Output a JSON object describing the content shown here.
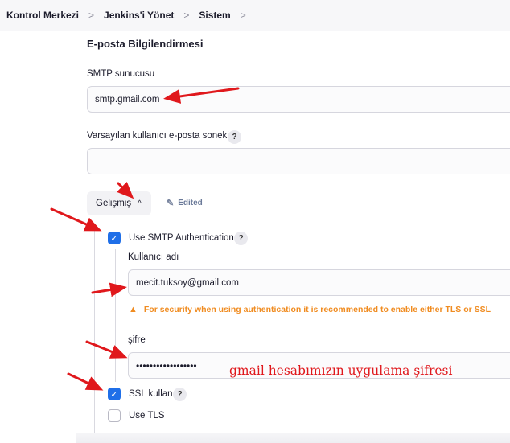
{
  "breadcrumb": {
    "items": [
      "Kontrol Merkezi",
      "Jenkins'i Yönet",
      "Sistem"
    ],
    "separator": ">"
  },
  "section": {
    "title": "E-posta Bilgilendirmesi"
  },
  "smtp": {
    "label": "SMTP sunucusu",
    "value": "smtp.gmail.com"
  },
  "suffix": {
    "label": "Varsayılan kullanıcı e-posta soneki",
    "value": "",
    "help": "?"
  },
  "advanced": {
    "label": "Gelişmiş",
    "chevron": "^",
    "edited": "Edited"
  },
  "auth": {
    "label": "Use SMTP Authentication",
    "checked": true,
    "help": "?",
    "username_label": "Kullanıcı adı",
    "username_value": "mecit.tuksoy@gmail.com",
    "warning": "For security when using authentication it is recommended to enable either TLS or SSL",
    "password_label": "şifre",
    "password_value": "••••••••••••••••••"
  },
  "ssl": {
    "label": "SSL kullan",
    "checked": true,
    "help": "?"
  },
  "tls": {
    "label": "Use TLS",
    "checked": false
  },
  "annotation": {
    "text": "gmail hesabımızın uygulama şifresi"
  },
  "colors": {
    "accent": "#1f6fe8",
    "warning": "#f08c21",
    "annotation": "#e0181c",
    "breadcrumb_bg": "#f7f7f9"
  },
  "icons": {
    "breadcrumb_separator": "chevron-right-icon",
    "advanced_chevron": "chevron-up-icon",
    "edited": "pencil-icon",
    "warning": "warning-triangle-icon",
    "checkbox": "check-icon",
    "help": "help-icon"
  }
}
